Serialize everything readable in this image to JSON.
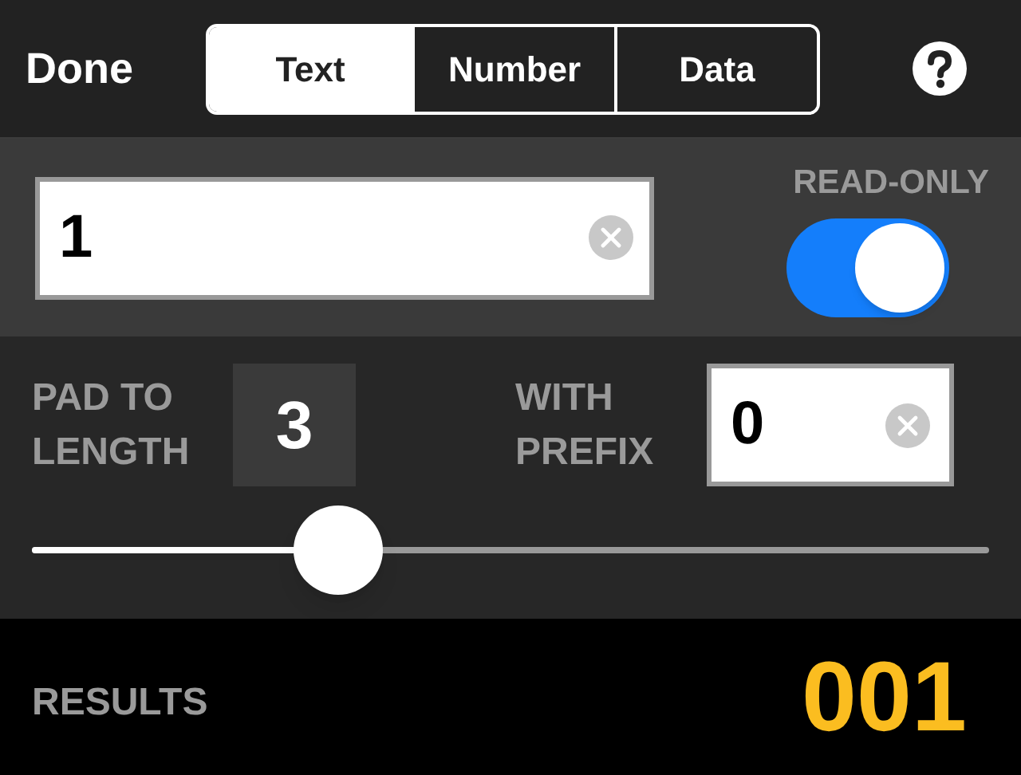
{
  "toolbar": {
    "done": "Done",
    "tabs": [
      {
        "label": "Text",
        "selected": true
      },
      {
        "label": "Number",
        "selected": false
      },
      {
        "label": "Data",
        "selected": false
      }
    ]
  },
  "value_field": {
    "value": "1"
  },
  "read_only": {
    "label": "READ-ONLY",
    "on": true
  },
  "padding": {
    "label": "PAD TO LENGTH",
    "length": "3",
    "prefix_label": "WITH PREFIX",
    "prefix_value": "0",
    "slider": {
      "level": 0.32
    }
  },
  "results": {
    "label": "RESULTS",
    "value": "001"
  }
}
